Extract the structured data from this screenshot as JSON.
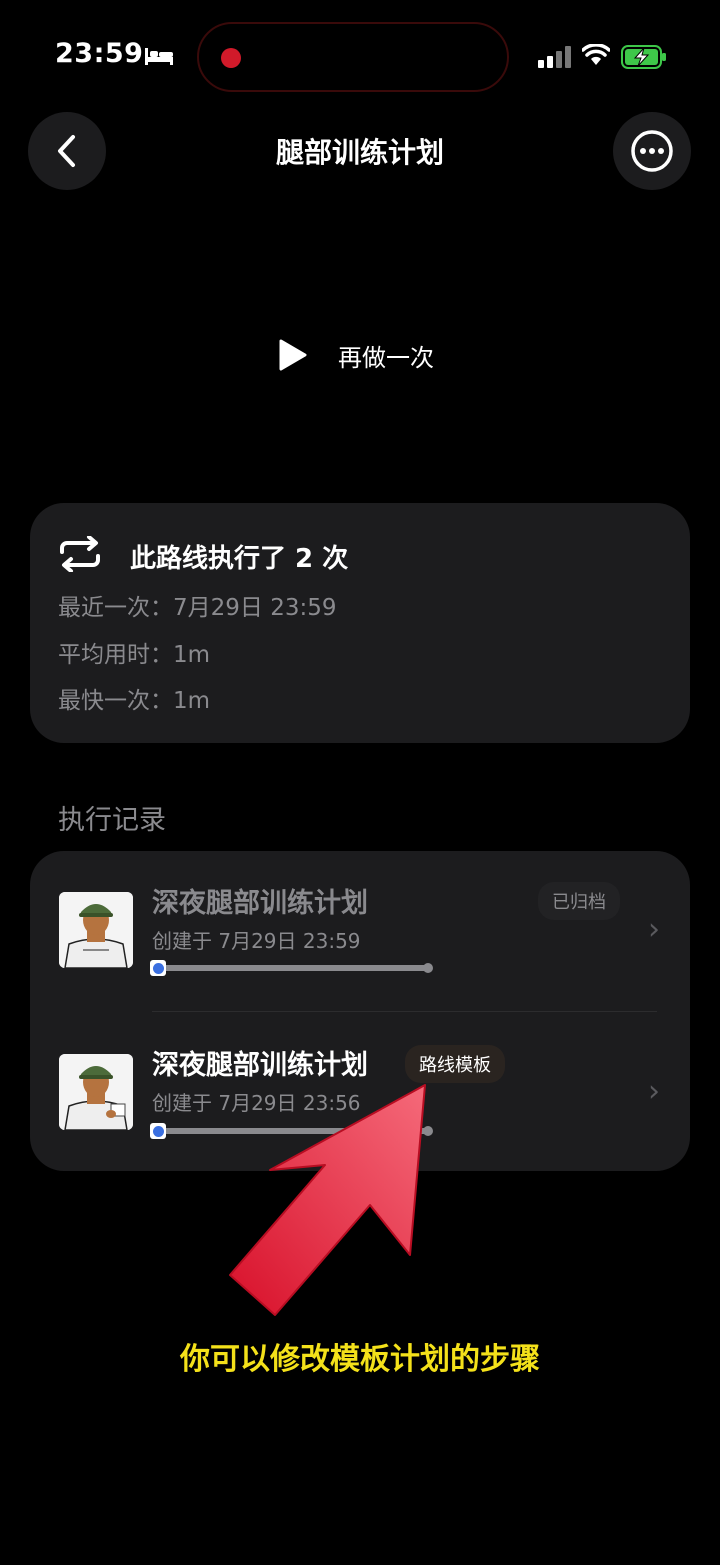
{
  "status_bar": {
    "time": "23:59"
  },
  "header": {
    "title": "腿部训练计划"
  },
  "redo": {
    "label": "再做一次"
  },
  "stats": {
    "title": "此路线执行了 2 次",
    "lines": [
      {
        "label": "最近一次：",
        "value": "7月29日 23:59"
      },
      {
        "label": "平均用时：",
        "value": "1m"
      },
      {
        "label": "最快一次：",
        "value": "1m"
      }
    ]
  },
  "records": {
    "section_title": "执行记录",
    "items": [
      {
        "title": "深夜腿部训练计划",
        "subtitle": "创建于 7月29日 23:59",
        "badge": "已归档",
        "progress": 0
      },
      {
        "title": "深夜腿部训练计划",
        "subtitle": "创建于 7月29日 23:56",
        "badge": "路线模板",
        "progress": 0
      }
    ]
  },
  "annotation": {
    "caption": "你可以修改模板计划的步骤",
    "arrow_color": "#e8223a",
    "caption_color": "#f4e11a"
  }
}
